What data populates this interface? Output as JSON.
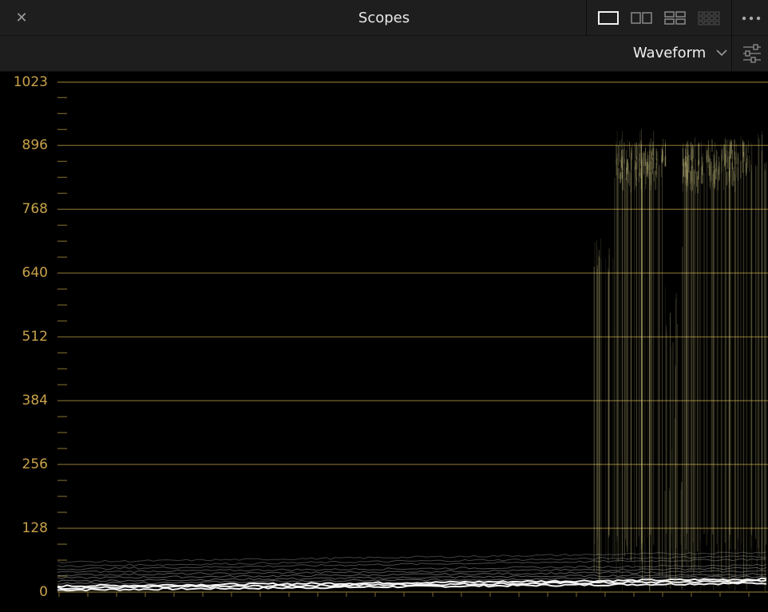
{
  "window": {
    "title": "Scopes",
    "close_glyph": "✕"
  },
  "layout_options": [
    "single-view-icon",
    "dual-view-icon",
    "quad-view-icon",
    "grid-view-icon"
  ],
  "toolbar": {
    "scope_type": "Waveform",
    "more_icon": "more-options-icon",
    "settings_icon": "sliders-icon"
  },
  "scope": {
    "axis_labels": [
      "1023",
      "896",
      "768",
      "640",
      "512",
      "384",
      "256",
      "128",
      "0"
    ],
    "axis_values": [
      1023,
      896,
      768,
      640,
      512,
      384,
      256,
      128,
      0
    ],
    "range": [
      0,
      1023
    ],
    "grid_color": "#6b5a26",
    "label_color": "#c9a24a",
    "trace_color": "#ffffff",
    "highlight_color": "#d8cf8a"
  }
}
